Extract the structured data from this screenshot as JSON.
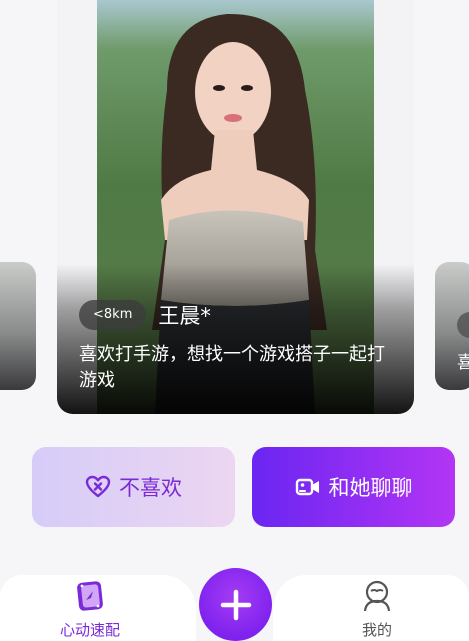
{
  "card": {
    "distance": "<8km",
    "name": "王晨*",
    "bio": "喜欢打手游，想找一个游戏搭子一起打游戏"
  },
  "next_card": {
    "bio_preview": "喜"
  },
  "actions": {
    "dislike_label": "不喜欢",
    "chat_label": "和她聊聊"
  },
  "nav": {
    "items": [
      {
        "label": "心动速配",
        "icon": "match-card-icon",
        "active": true
      },
      {
        "label": "我的",
        "icon": "profile-icon",
        "active": false
      }
    ],
    "fab_icon": "plus-icon"
  },
  "colors": {
    "accent": "#7a2bd6",
    "chat_start": "#6a26f2",
    "chat_end": "#b335f4"
  }
}
